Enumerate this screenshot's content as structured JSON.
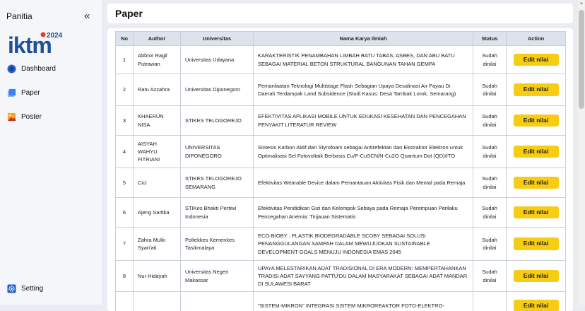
{
  "sidebar": {
    "brand": "Panitia",
    "logo_text": "iktm",
    "logo_year": "2024",
    "items": [
      {
        "label": "Dashboard",
        "icon": "dashboard-icon"
      },
      {
        "label": "Paper",
        "icon": "paper-icon"
      },
      {
        "label": "Poster",
        "icon": "poster-icon"
      }
    ],
    "setting": {
      "label": "Setting",
      "icon": "gear-icon"
    }
  },
  "page": {
    "title": "Paper"
  },
  "table": {
    "headers": [
      "No",
      "Author",
      "Universitas",
      "Nama Karya Ilmiah",
      "Status",
      "Action"
    ],
    "edit_label": "Edit nilai",
    "rows": [
      {
        "no": "1",
        "author": "Abbror Ragil Putrawan",
        "univ": "Universitas Udayana",
        "title": "KARAKTERISTIK PENAMBAHAN LIMBAH BATU TABAS, ASBES, DAN ABU BATU SEBAGAI MATERIAL BETON STRUKTURAL BANGUNAN TAHAN GEMPA",
        "status": "Sudah dinilai"
      },
      {
        "no": "2",
        "author": "Ratu Azzahra",
        "univ": "Universitas Diponegoro",
        "title": "Pemanfaatan Teknologi Multistage Flash Sebagian Upaya Desalinasi Air Payau Di Daerah Terdampak Land Subsidence (Studi Kasus: Desa Tambak Lorok, Semarang)",
        "status": "Sudah dinilai"
      },
      {
        "no": "3",
        "author": "KHAERUN NISA",
        "univ": "STIKES TELOGOREJO",
        "title": "EFEKTIVITAS APLIKASI MOBILE UNTUK EDUKASI KESEHATAN DAN PENCEGAHAN PENYAKIT LITERATUR REVIEW",
        "status": "Sudah dinilai"
      },
      {
        "no": "4",
        "author": "AISYAH WAHYU FITRIANI",
        "univ": "UNIVERSITAS DIPONEGORO",
        "title": "Sintesis Karbon Aktif dari Styrofoam sebagai Antirefektan dan Ekstraktor Elektron untuk Optimalisasi Sel Fotovoltaik Berbasis Cu/P-CuSCN/N-Cu2O Quantum Dot (QD)/ITO",
        "status": "Sudah dinilai"
      },
      {
        "no": "5",
        "author": "Cici",
        "univ": "STIKES TELOGOREJO SEMARANG",
        "title": "Efektivitas Wearable Device dalam Pemantauan Aktivitas Fisik dan Mental pada Remaja",
        "status": "Sudah dinilai"
      },
      {
        "no": "6",
        "author": "Ajeng Sartika",
        "univ": "STIKes Bhakti Pertiwi Indonesia",
        "title": "Efektivitas Pendidikan Gizi dan Kelompok Sebaya pada Remaja Perempuan Perilaku Pencegahan Anemia: Tinjauan Sistematis",
        "status": "Sudah dinilai"
      },
      {
        "no": "7",
        "author": "Zahra Mulki Syari'ati",
        "univ": "Poltekkes Kemenkes Tasikmalaya",
        "title": "ECO-BIOBY : PLASTIK BIODEGRADABLE SCOBY SEBAGAI SOLUSI PENANGGULANGAN SAMPAH DALAM MEWUJUDKAN SUSTAINABLE DEVELOPMENT GOALS MENUJU INDONESIA EMAS 2045",
        "status": "Sudah dinilai"
      },
      {
        "no": "8",
        "author": "Nur Hidayah",
        "univ": "Universitas Negeri Makassar",
        "title": "UPAYA MELESTARIKAN ADAT TRADISIONAL DI ERA MODERN: MEMPERTAHANKAN TRADISI ADAT SAYYANG PATTU'DU DALAM MASYARAKAT SEBAGAI ADAT MANDAR DI SULAWESI BARAT",
        "status": "Sudah dinilai"
      },
      {
        "no": "",
        "author": "",
        "univ": "",
        "title": "\"SISTEM-MIKRON\" INTEGRASI SISTEM MIKROREAKTOR FOTO-ELEKTRO-",
        "status": ""
      }
    ]
  },
  "colors": {
    "accent": "#f6cc14",
    "header_bg": "#dde3ec",
    "page_bg": "#e9edf3",
    "dashboard_icon": "#2a62c9",
    "paper_icon": "#3b82f6"
  }
}
